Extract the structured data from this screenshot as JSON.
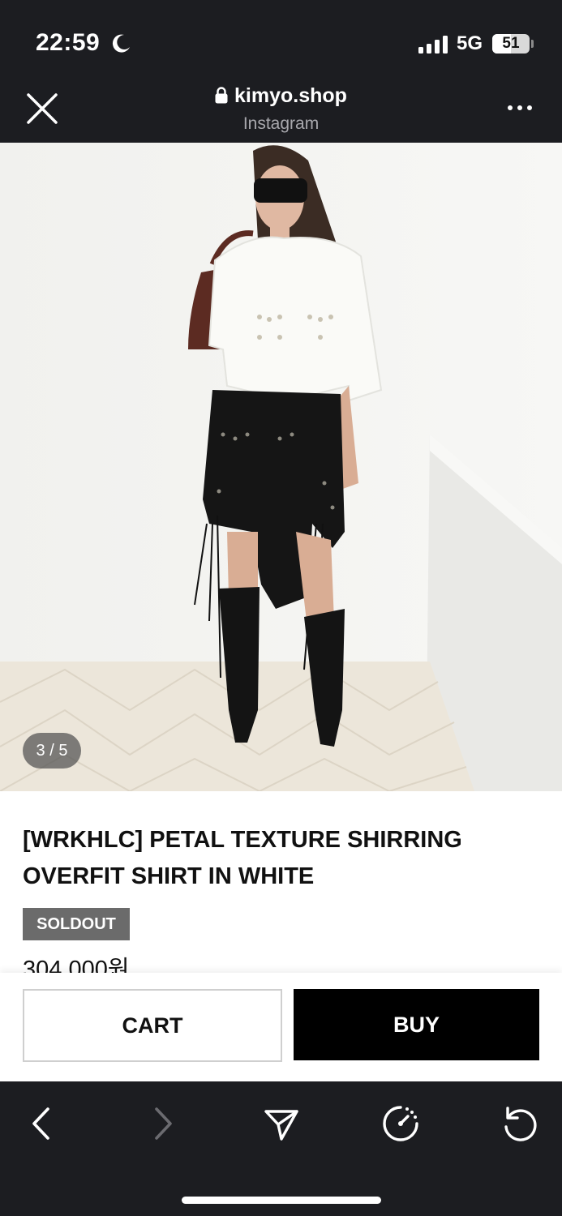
{
  "status_bar": {
    "time": "22:59",
    "network": "5G",
    "battery_level": "51",
    "battery_fraction": 0.51
  },
  "browser": {
    "domain": "kimyo.shop",
    "source": "Instagram",
    "icons": {
      "close": "close-icon",
      "lock": "lock-icon",
      "more": "more-icon"
    }
  },
  "gallery": {
    "counter": "3 / 5"
  },
  "product": {
    "title": "[WRKHLC] PETAL TEXTURE SHIRRING OVERFIT SHIRT IN WHITE",
    "status_badge": "SOLDOUT",
    "price": "304.000원"
  },
  "actions": {
    "cart_label": "CART",
    "buy_label": "BUY"
  },
  "toolbar": {
    "items": [
      "back-icon",
      "forward-icon",
      "share-icon",
      "speed-icon",
      "reload-icon"
    ]
  },
  "colors": {
    "chrome_background": "#1c1d21",
    "buy_button": "#000000",
    "soldout_badge": "#6b6b6b",
    "text": "#111111"
  }
}
